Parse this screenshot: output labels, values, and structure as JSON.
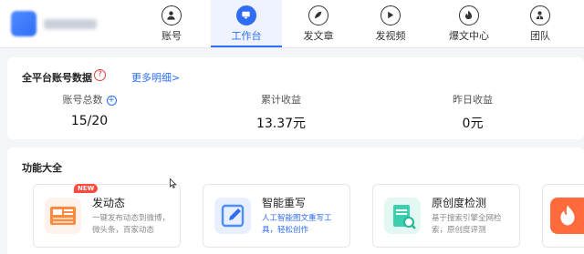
{
  "nav": {
    "items": [
      {
        "label": "账号",
        "icon": "user-icon"
      },
      {
        "label": "工作台",
        "icon": "monitor-icon",
        "active": true
      },
      {
        "label": "发文章",
        "icon": "feather-icon"
      },
      {
        "label": "发视频",
        "icon": "play-icon"
      },
      {
        "label": "爆文中心",
        "icon": "fire-icon"
      },
      {
        "label": "团队",
        "icon": "team-icon"
      }
    ]
  },
  "account_data": {
    "title": "全平台账号数据",
    "more_link": "更多明细>",
    "stats": [
      {
        "label": "账号总数",
        "value": "15/20"
      },
      {
        "label": "累计收益",
        "value": "13.37元"
      },
      {
        "label": "昨日收益",
        "value": "0元"
      }
    ]
  },
  "features": {
    "title": "功能大全",
    "items": [
      {
        "title": "发动态",
        "badge": "NEW",
        "desc": "一键发布动态到微博，微头条，百家动态"
      },
      {
        "title": "智能重写",
        "desc": "人工智能图文重写工具，轻松创作"
      },
      {
        "title": "原创度检测",
        "desc": "基于搜索引擎全网检索，原创度评测"
      }
    ]
  },
  "colors": {
    "accent": "#2f6df6",
    "badge": "#ff4a3d",
    "help": "#e0403a"
  }
}
